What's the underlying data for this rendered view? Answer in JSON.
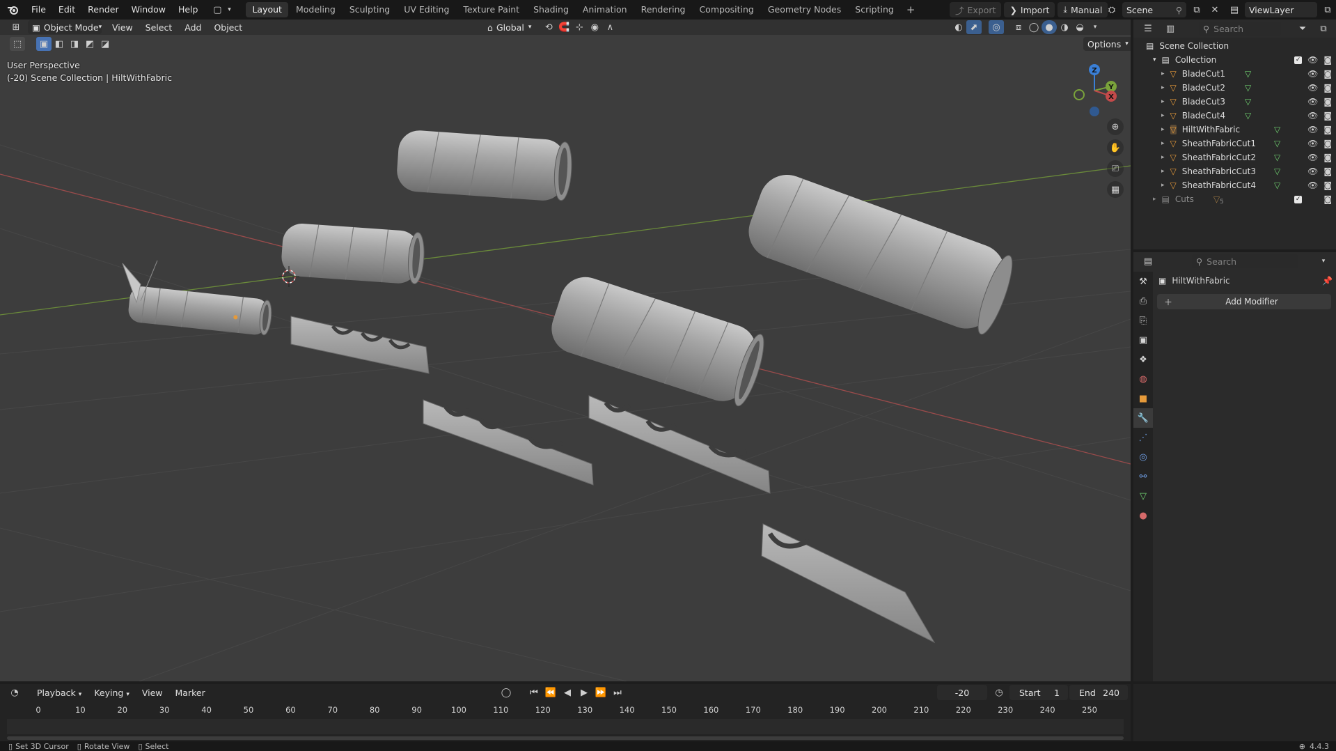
{
  "app": {
    "menus": [
      "File",
      "Edit",
      "Render",
      "Window",
      "Help"
    ],
    "workspace_tabs": [
      "Layout",
      "Modeling",
      "Sculpting",
      "UV Editing",
      "Texture Paint",
      "Shading",
      "Animation",
      "Rendering",
      "Compositing",
      "Geometry Nodes",
      "Scripting"
    ],
    "active_workspace": "Layout",
    "add_tab": "+",
    "export_label": "Export",
    "import_label": "Import",
    "manual_label": "Manual",
    "scene_label": "Scene",
    "viewlayer_label": "ViewLayer"
  },
  "viewport": {
    "mode": "Object Mode",
    "menus": [
      "View",
      "Select",
      "Add",
      "Object"
    ],
    "orientation": "Global",
    "options_label": "Options",
    "perspective_text": "User Perspective",
    "context_text": "(-20) Scene Collection | HiltWithFabric",
    "gizmo_axes": {
      "x": "X",
      "y": "Y",
      "z": "Z"
    }
  },
  "outliner": {
    "search_placeholder": "Search",
    "root": "Scene Collection",
    "collection": "Collection",
    "items": [
      {
        "name": "BladeCut1",
        "selected": false
      },
      {
        "name": "BladeCut2",
        "selected": false
      },
      {
        "name": "BladeCut3",
        "selected": false
      },
      {
        "name": "BladeCut4",
        "selected": false
      },
      {
        "name": "HiltWithFabric",
        "selected": true
      },
      {
        "name": "SheathFabricCut1",
        "selected": false
      },
      {
        "name": "SheathFabricCut2",
        "selected": false
      },
      {
        "name": "SheathFabricCut3",
        "selected": false
      },
      {
        "name": "SheathFabricCut4",
        "selected": false
      }
    ],
    "cuts_collection": "Cuts",
    "cuts_count": "5"
  },
  "properties": {
    "search_placeholder": "Search",
    "object_name": "HiltWithFabric",
    "add_modifier_label": "Add Modifier"
  },
  "timeline": {
    "menus": [
      "Playback",
      "Keying",
      "View",
      "Marker"
    ],
    "current_frame": "-20",
    "start_label": "Start",
    "start_value": "1",
    "end_label": "End",
    "end_value": "240",
    "ticks": [
      "0",
      "10",
      "20",
      "30",
      "40",
      "50",
      "60",
      "70",
      "80",
      "90",
      "100",
      "110",
      "120",
      "130",
      "140",
      "150",
      "160",
      "170",
      "180",
      "190",
      "200",
      "210",
      "220",
      "230",
      "240",
      "250"
    ]
  },
  "statusbar": {
    "items": [
      "Set 3D Cursor",
      "Rotate View",
      "Select"
    ],
    "version": "4.4.3"
  },
  "colors": {
    "accent_orange": "#e69a3a",
    "mesh_green": "#6fcf6f",
    "axis_red": "#c34a4a",
    "axis_green": "#7aa33b",
    "axis_blue": "#3a7fd6",
    "viewport_bg": "#3d3d3d"
  }
}
